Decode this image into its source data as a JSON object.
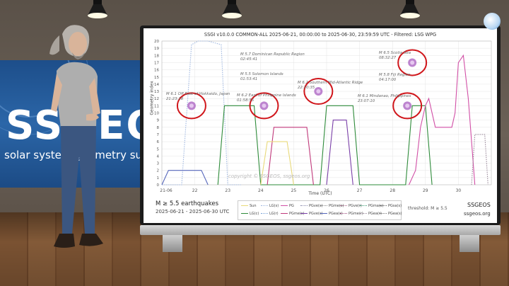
{
  "chart_title": "SSGI v10.0.0 COMMON-ALL 2025-06-21, 00:00:00 to 2025-06-30, 23:59:59 UTC - Filtered: LSG WPG",
  "y_axis_label": "Geometry index",
  "x_axis_label": "Time (UTC)",
  "backdrop": {
    "brand": "SSGEOS",
    "subtitle": "solar system geometry survey"
  },
  "footer": {
    "title": "M ≥ 5.5 earthquakes",
    "range": "2025-06-21 - 2025-06-30 UTC",
    "threshold": "threshold: M ≥ 5.5",
    "brand": "SSGEOS",
    "url": "ssgeos.org"
  },
  "watermark": "copyright © SSGEOS, ssgeos.org",
  "legend": [
    {
      "label": "Sun",
      "color": "#e8d97a",
      "dash": "solid"
    },
    {
      "label": "LG(s)",
      "color": "#9fb7e0",
      "dash": "dotted"
    },
    {
      "label": "PG",
      "color": "#d14fa6",
      "dash": "solid"
    },
    {
      "label": "PGve(s)",
      "color": "#8888aa",
      "dash": "dotted"
    },
    {
      "label": "PGme(s)",
      "color": "#888888",
      "dash": "dotted"
    },
    {
      "label": "PGve(r)",
      "color": "#aa6688",
      "dash": "dotted"
    },
    {
      "label": "PGma(s)",
      "color": "#3d9d76",
      "dash": "dotted"
    },
    {
      "label": "PGsa(s)",
      "color": "#666666",
      "dash": "dotted"
    },
    {
      "label": "LG(c)",
      "color": "#2e8b3a",
      "dash": "solid"
    },
    {
      "label": "LG(r)",
      "color": "#7aa3d9",
      "dash": "dotted"
    },
    {
      "label": "PGme(c)",
      "color": "#c0397b",
      "dash": "solid"
    },
    {
      "label": "PGve(c)",
      "color": "#7a3fa8",
      "dash": "solid"
    },
    {
      "label": "PGea(c)",
      "color": "#5566bb",
      "dash": "solid"
    },
    {
      "label": "PGme(r)",
      "color": "#994477",
      "dash": "dotted"
    },
    {
      "label": "PGea(r)",
      "color": "#998899",
      "dash": "dotted"
    },
    {
      "label": "PGea(s)",
      "color": "#777777",
      "dash": "dotted"
    }
  ],
  "annotations": [
    {
      "mag": "M 6.1 Off East of Hokkaido, Japan",
      "time": "21:23:18"
    },
    {
      "mag": "M 5.7 Dominican Republic Region",
      "time": "02:45:41"
    },
    {
      "mag": "M 5.5 Solomon Islands",
      "time": "01:53:41"
    },
    {
      "mag": "M 6.2 East of Philippine Islands",
      "time": "01:58:55"
    },
    {
      "mag": "M 6.2 Southern Mid-Atlantic Ridge",
      "time": "22:10:35"
    },
    {
      "mag": "M 6.5 Scotia Sea",
      "time": "08:32:27"
    },
    {
      "mag": "M 5.8 Fiji Region",
      "time": "04:17:00"
    },
    {
      "mag": "M 6.1 Mindanao, Philippines",
      "time": "23:07:10"
    }
  ],
  "chart_data": {
    "type": "line",
    "title": "SSGI v10.0.0 COMMON-ALL 2025-06-21, 00:00:00 to 2025-06-30, 23:59:59 UTC - Filtered: LSG WPG",
    "xlabel": "Time (UTC)",
    "ylabel": "Geometry index",
    "x_ticks": [
      "21-06",
      "22",
      "23",
      "24",
      "25",
      "26",
      "27",
      "28",
      "29",
      "30"
    ],
    "y_ticks": [
      "0",
      "1",
      "2",
      "3",
      "4",
      "5",
      "6",
      "7",
      "8",
      "9",
      "10",
      "11",
      "12",
      "13",
      "14",
      "15",
      "16",
      "17",
      "18",
      "19",
      "20"
    ],
    "ylim": [
      0,
      20
    ],
    "xlim": [
      21,
      31
    ],
    "grid": true,
    "series": [
      {
        "name": "LG(s)",
        "color": "#9fb7e0",
        "x": [
          21.0,
          21.6,
          21.9,
          22.1,
          22.4,
          22.8,
          23.0,
          23.4
        ],
        "y": [
          0,
          0,
          19.5,
          20,
          20,
          19.5,
          0,
          0
        ]
      },
      {
        "name": "LG(c)",
        "color": "#2e8b3a",
        "x": [
          22.7,
          22.9,
          23.0,
          23.2,
          23.4,
          23.6,
          23.8,
          24.0,
          25.8,
          26.0,
          26.2,
          26.5,
          26.8,
          27.0,
          28.4,
          28.6,
          28.8,
          29.0,
          29.2
        ],
        "y": [
          0,
          11,
          11,
          11,
          11,
          11,
          11,
          0,
          0,
          11,
          11,
          11,
          11,
          0,
          0,
          11,
          11,
          11,
          0
        ]
      },
      {
        "name": "PG",
        "color": "#d14fa6",
        "x": [
          28.5,
          28.7,
          28.85,
          29.0,
          29.1,
          29.3,
          29.5,
          29.8,
          29.9,
          30.0,
          30.15,
          30.3,
          30.5
        ],
        "y": [
          0,
          2,
          8,
          11,
          12,
          8,
          8,
          8,
          10,
          17,
          18,
          12,
          0
        ]
      },
      {
        "name": "PGme(c)",
        "color": "#c0397b",
        "x": [
          24.2,
          24.4,
          24.6,
          24.8,
          25.0,
          25.2,
          25.4,
          25.6
        ],
        "y": [
          0,
          8,
          8,
          8,
          8,
          8,
          8,
          0
        ]
      },
      {
        "name": "PGve(c)",
        "color": "#7a3fa8",
        "x": [
          26.0,
          26.2,
          26.4,
          26.6,
          26.8
        ],
        "y": [
          0,
          9,
          9,
          9,
          0
        ]
      },
      {
        "name": "PGea(c)",
        "color": "#5566bb",
        "x": [
          21.0,
          21.2,
          21.8,
          22.0,
          22.2,
          22.4
        ],
        "y": [
          0,
          2,
          2,
          2,
          2,
          0
        ]
      },
      {
        "name": "Sun",
        "color": "#e8d97a",
        "x": [
          24.0,
          24.2,
          24.4,
          24.6,
          24.8,
          25.0
        ],
        "y": [
          0,
          6,
          6,
          6,
          6,
          0
        ]
      },
      {
        "name": "PGea(r)",
        "color": "#998899",
        "x": [
          30.4,
          30.5,
          30.6,
          30.7,
          30.8,
          30.9
        ],
        "y": [
          0,
          7,
          7,
          7,
          7,
          0
        ]
      }
    ],
    "circled_events": [
      {
        "x": 21.9,
        "y": 11
      },
      {
        "x": 24.1,
        "y": 11
      },
      {
        "x": 25.75,
        "y": 13
      },
      {
        "x": 28.45,
        "y": 11
      },
      {
        "x": 28.6,
        "y": 17
      }
    ]
  }
}
